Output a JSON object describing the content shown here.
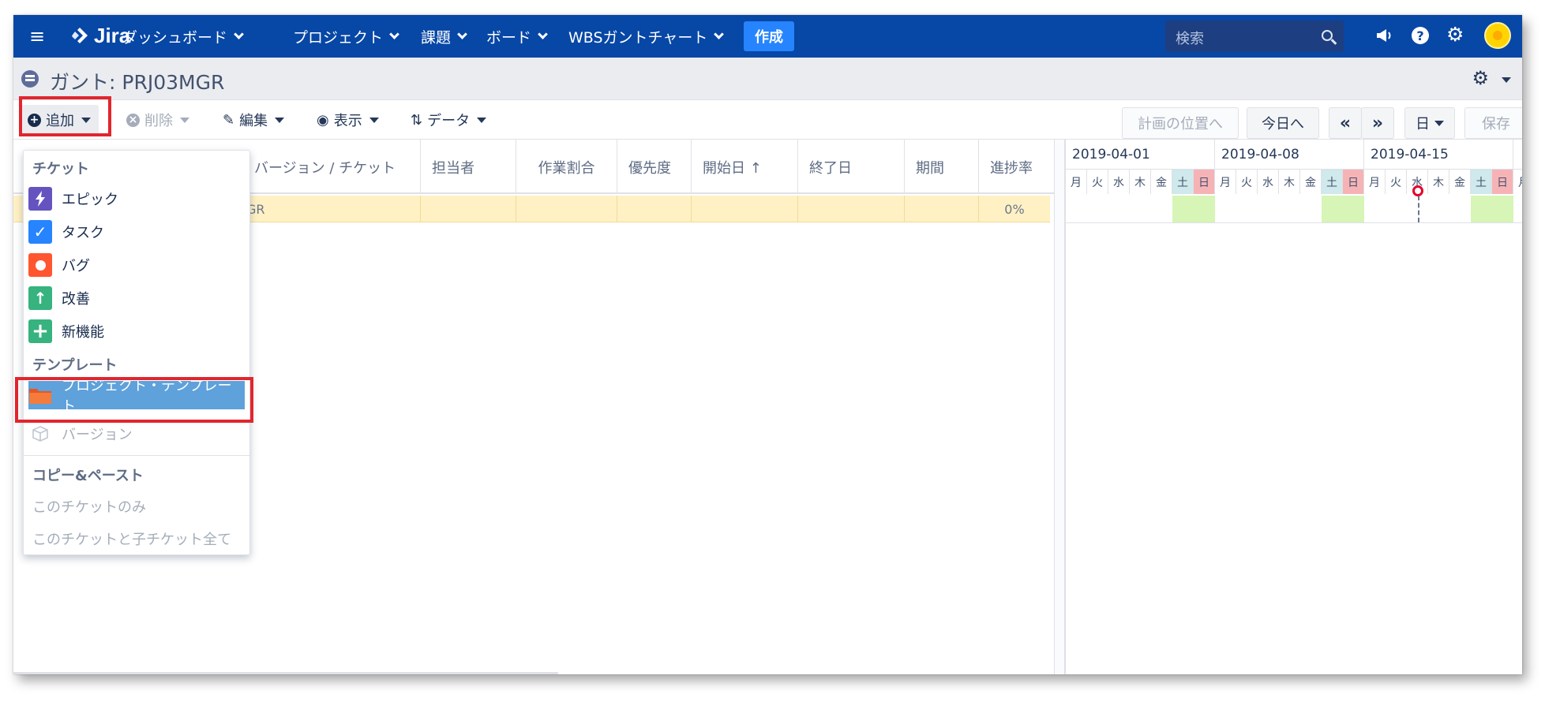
{
  "topnav": {
    "logo": "Jira",
    "items": [
      {
        "label": "ダッシュボード"
      },
      {
        "label": "プロジェクト"
      },
      {
        "label": "課題"
      },
      {
        "label": "ボード"
      },
      {
        "label": "WBSガントチャート"
      }
    ],
    "create_label": "作成",
    "search_placeholder": "検索",
    "icons": [
      "menu-icon",
      "megaphone-icon",
      "help-icon",
      "gear-icon",
      "avatar"
    ],
    "colors": {
      "nav_bg": "#0747a6",
      "create_bg": "#2684ff"
    }
  },
  "title": {
    "label": "ガント: PRJ03MGR"
  },
  "toolbar": {
    "add_label": "追加",
    "delete_label": "削除",
    "edit_label": "編集",
    "view_label": "表示",
    "data_label": "データ",
    "plan_position_label": "計画の位置へ",
    "today_label": "今日へ",
    "prev_label": "«",
    "next_label": "»",
    "scale_label": "日",
    "save_label": "保存"
  },
  "table": {
    "columns": [
      "バージョン / チケット",
      "担当者",
      "作業割合",
      "優先度",
      "開始日 ↑",
      "終了日",
      "期間",
      "進捗率"
    ],
    "row": {
      "ticket_fragment": "GR",
      "progress": "0%"
    }
  },
  "gantt": {
    "weeks": [
      "2019-04-01",
      "2019-04-08",
      "2019-04-15"
    ],
    "days": [
      "月",
      "火",
      "水",
      "木",
      "金",
      "土",
      "日",
      "月",
      "火",
      "水",
      "木",
      "金",
      "土",
      "日",
      "月",
      "火",
      "水",
      "木",
      "金",
      "土",
      "日",
      "月"
    ],
    "today_index": 16
  },
  "dropdown": {
    "ticket_header": "チケット",
    "tickets": [
      {
        "label": "エピック",
        "icon": "epic-icon",
        "color": "#6554c0"
      },
      {
        "label": "タスク",
        "icon": "task-icon",
        "color": "#2684ff"
      },
      {
        "label": "バグ",
        "icon": "bug-icon",
        "color": "#ff5630"
      },
      {
        "label": "改善",
        "icon": "improvement-icon",
        "color": "#36b37e"
      },
      {
        "label": "新機能",
        "icon": "new-feature-icon",
        "color": "#36b37e"
      }
    ],
    "template_header": "テンプレート",
    "project_template": "プロジェクト・テンプレート",
    "version": "バージョン",
    "copy_header": "コピー&ペースト",
    "copy_this": "このチケットのみ",
    "copy_all": "このチケットと子チケット全て"
  }
}
